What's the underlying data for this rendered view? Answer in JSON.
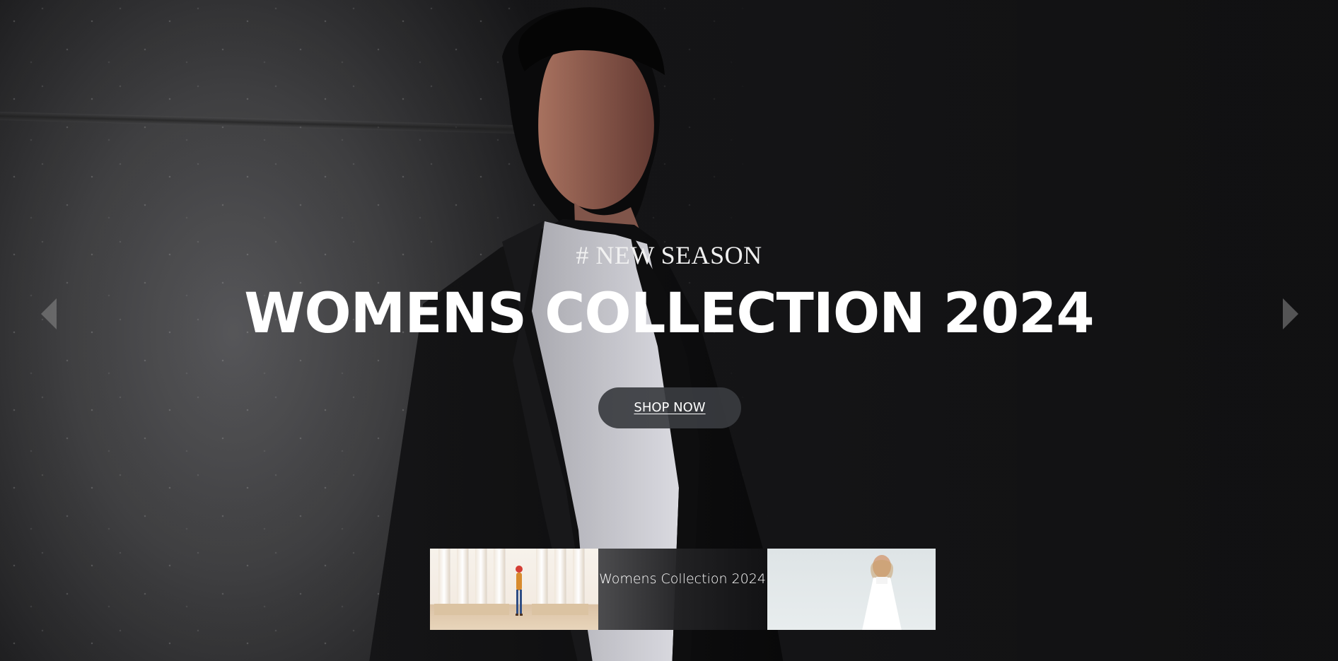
{
  "hero": {
    "eyebrow": "# NEW SEASON",
    "headline": "WOMENS COLLECTION 2024",
    "cta_label": "SHOP NOW"
  },
  "thumbnails": [
    {
      "caption": ""
    },
    {
      "caption": "Womens Collection 2024"
    },
    {
      "caption": ""
    }
  ],
  "colors": {
    "background": "#0f0f10",
    "button_bg": "#3a3c40",
    "text": "#ffffff",
    "arrow": "#8c8c8c"
  },
  "icons": {
    "left_arrow": "chevron-left-icon",
    "right_arrow": "chevron-right-icon"
  }
}
